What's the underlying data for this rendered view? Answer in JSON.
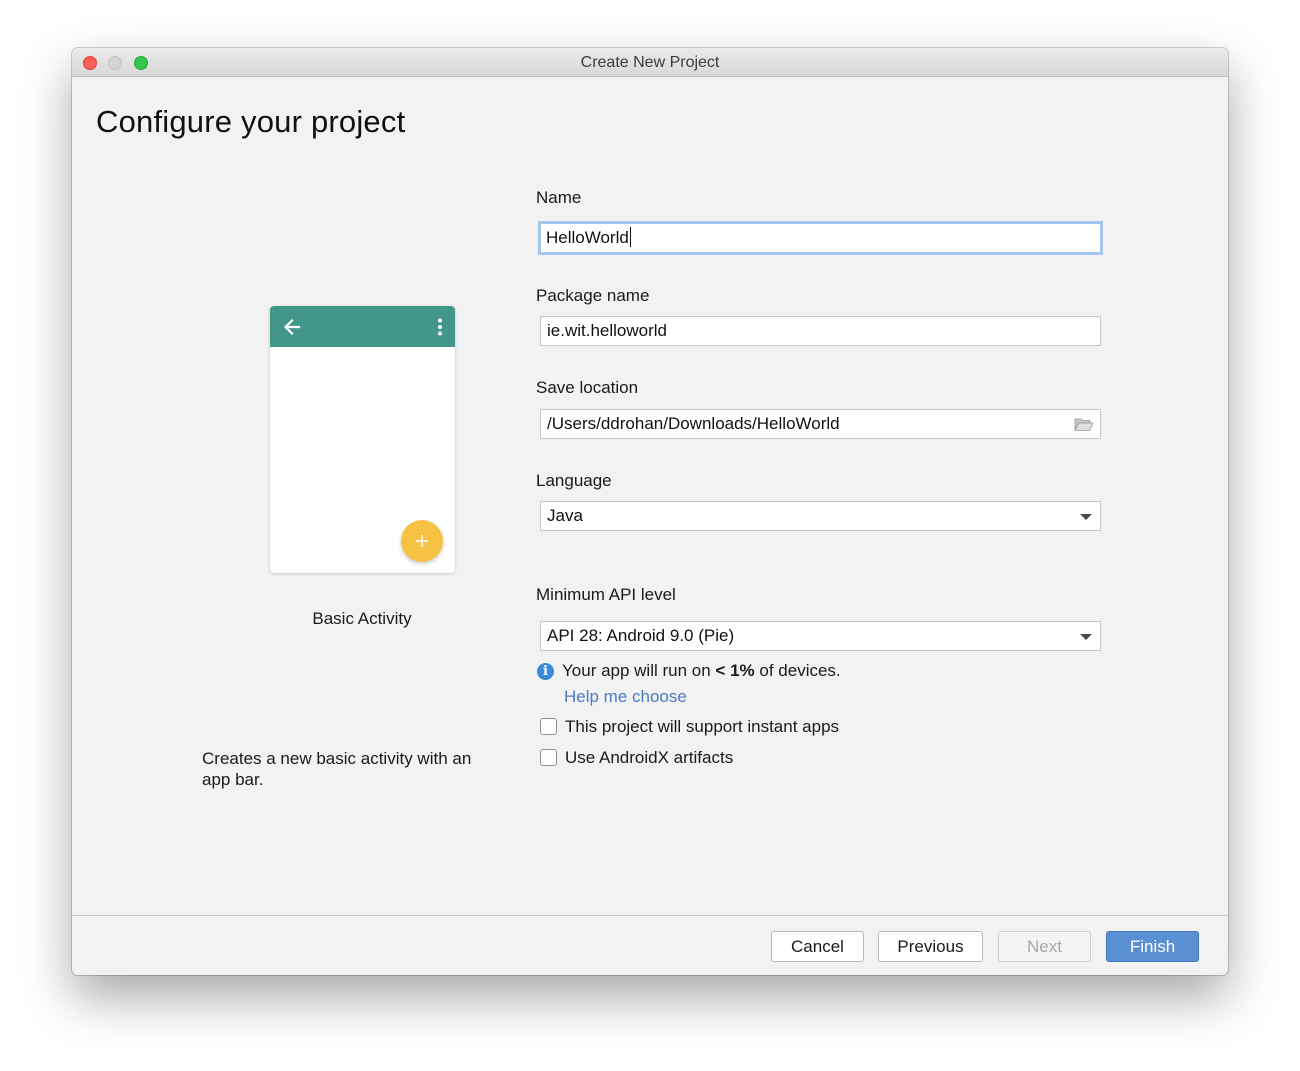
{
  "window": {
    "title": "Create New Project"
  },
  "page": {
    "heading": "Configure your project"
  },
  "template": {
    "name": "Basic Activity",
    "description": "Creates a new basic activity with an app bar.",
    "appbar_color": "#43968a",
    "fab_color": "#f6c244",
    "fab_symbol": "+"
  },
  "form": {
    "name_label": "Name",
    "name_value": "HelloWorld",
    "package_label": "Package name",
    "package_value": "ie.wit.helloworld",
    "location_label": "Save location",
    "location_value": "/Users/ddrohan/Downloads/HelloWorld",
    "location_icon": "folder-open-icon",
    "language_label": "Language",
    "language_value": "Java",
    "api_label": "Minimum API level",
    "api_value": "API 28: Android 9.0 (Pie)",
    "info_prefix": "Your app will run on ",
    "info_bold": "< 1%",
    "info_suffix": " of devices.",
    "help_link": "Help me choose",
    "instant_apps_label": "This project will support instant apps",
    "instant_apps_checked": false,
    "androidx_label": "Use AndroidX artifacts",
    "androidx_checked": false
  },
  "buttons": {
    "cancel": "Cancel",
    "previous": "Previous",
    "next": "Next",
    "finish": "Finish"
  },
  "colors": {
    "accent": "#5a8fd4",
    "link": "#4b7bc4",
    "focus_ring": "#a5c4ee"
  }
}
